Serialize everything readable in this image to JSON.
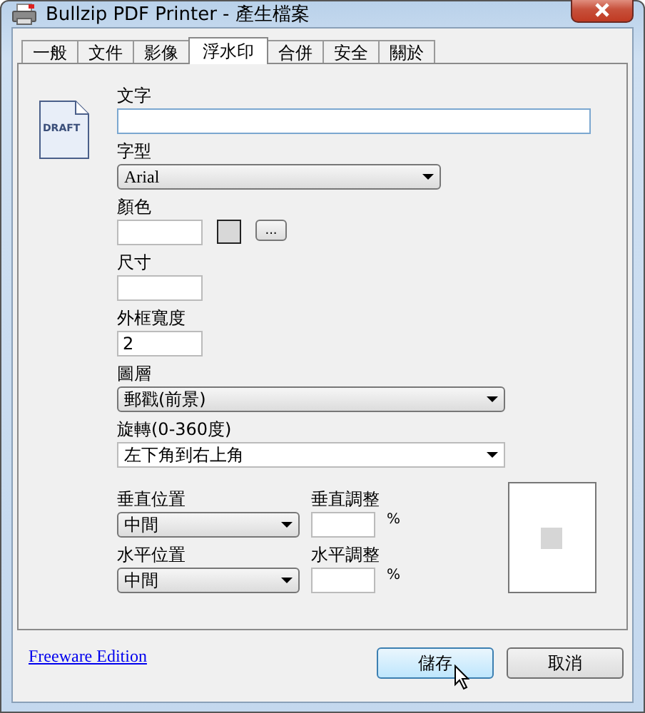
{
  "window": {
    "title": "Bullzip PDF Printer - 產生檔案"
  },
  "tabs": [
    {
      "label": "一般",
      "selected": false
    },
    {
      "label": "文件",
      "selected": false
    },
    {
      "label": "影像",
      "selected": false
    },
    {
      "label": "浮水印",
      "selected": true
    },
    {
      "label": "合併",
      "selected": false
    },
    {
      "label": "安全",
      "selected": false
    },
    {
      "label": "關於",
      "selected": false
    }
  ],
  "watermark": {
    "icon_text": "DRAFT",
    "text": {
      "label": "文字"
    },
    "font": {
      "label": "字型",
      "value": "Arial"
    },
    "color": {
      "label": "顏色",
      "browse": "..."
    },
    "size": {
      "label": "尺寸"
    },
    "outline_width": {
      "label": "外框寬度",
      "value": "2"
    },
    "layer": {
      "label": "圖層",
      "value": "郵戳(前景)"
    },
    "rotation": {
      "label": "旋轉(0-360度)",
      "value": "左下角到右上角"
    },
    "vertical_position": {
      "label": "垂直位置",
      "value": "中間"
    },
    "vertical_adjust": {
      "label": "垂直調整",
      "unit": "%"
    },
    "horizontal_position": {
      "label": "水平位置",
      "value": "中間"
    },
    "horizontal_adjust": {
      "label": "水平調整",
      "unit": "%"
    }
  },
  "footer": {
    "link": "Freeware Edition",
    "buttons": [
      "儲存",
      "取消"
    ]
  }
}
